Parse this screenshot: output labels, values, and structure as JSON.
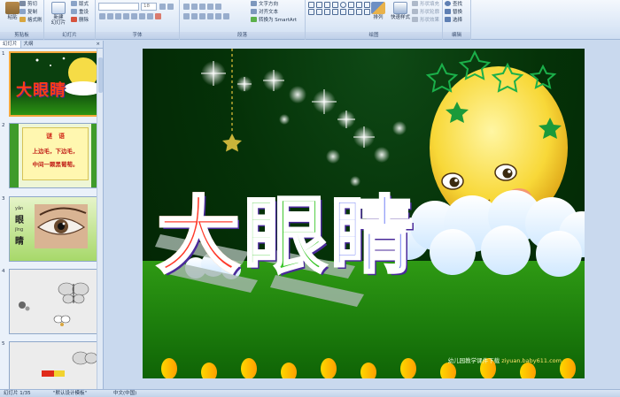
{
  "ribbon": {
    "groups": {
      "clipboard": "剪贴板",
      "slides": "幻灯片",
      "font": "字体",
      "paragraph": "段落",
      "drawing": "绘图",
      "editing": "编辑"
    },
    "paste": "粘贴",
    "cut": "剪切",
    "copy": "复制",
    "format_painter": "格式刷",
    "new_slide": "新建\n幻灯片",
    "layout": "版式",
    "reset": "重设",
    "delete": "删除",
    "font_size": "18",
    "text_direction": "文字方向",
    "align_text": "对齐文本",
    "convert_smartart": "转换为 SmartArt",
    "arrange": "排列",
    "quick_styles": "快速样式",
    "shape_fill": "形状填充",
    "shape_outline": "形状轮廓",
    "shape_effects": "形状效果",
    "find": "查找",
    "replace": "替换",
    "select": "选择"
  },
  "left_pane": {
    "tab_slides": "幻灯片",
    "tab_outline": "大纲",
    "close": "×",
    "slide_numbers": [
      "1",
      "2",
      "3",
      "4",
      "5"
    ],
    "thumb1_title": "大眼睛",
    "thumb2": {
      "heading": "谜　语",
      "line1": "上边毛，下边毛，",
      "line2": "中间一颗黑葡萄。"
    },
    "thumb3": {
      "pinyin1": "yǎn",
      "char1": "眼",
      "pinyin2": "jīng",
      "char2": "睛"
    }
  },
  "slide": {
    "title_chars": [
      "大",
      "眼",
      "睛"
    ],
    "watermark_text": "幼儿园教学课件下载",
    "watermark_url": "ziyuan.baby611.com"
  },
  "status": {
    "slide_count": "幻灯片 1/35",
    "theme": "\"默认设计模板\"",
    "language": "中文(中国)"
  },
  "colors": {
    "accent_selection": "#f3a83b",
    "title_gradient": [
      "#ff2a18",
      "#ff9b00",
      "#36d02a",
      "#2b5cff",
      "#a12bd9"
    ]
  }
}
